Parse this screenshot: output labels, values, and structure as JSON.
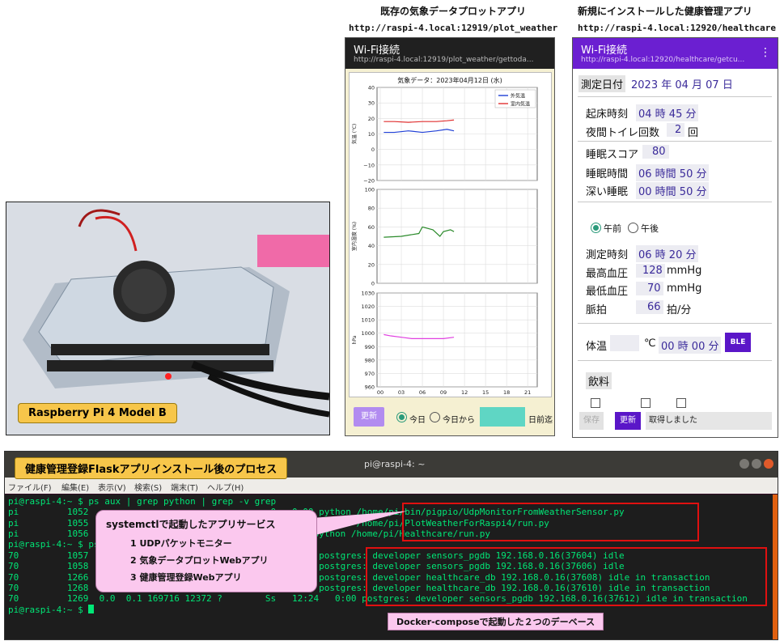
{
  "captions": {
    "plot_app": "既存の気象データプロットアプリ",
    "plot_url": "http://raspi-4.local:12919/plot_weather",
    "hc_app": "新規にインストールした健康管理アプリ",
    "hc_url": "http://raspi-4.local:12920/healthcare"
  },
  "photo": {
    "label": "Raspberry Pi 4 Model B"
  },
  "plot_phone": {
    "title": "Wi-Fi接続",
    "subtitle": "http://raspi-4.local:12919/plot_weather/gettoda...",
    "chart_title": "気象データ：2023年04月12日 (水)",
    "refresh_button": "更新",
    "radio_today": "今日",
    "radio_from_today": "今日から",
    "days_before": "日前迄",
    "colors": {
      "outdoor": "#1f3fd6",
      "indoor": "#e03030",
      "humidity": "#2a8a2a",
      "pressure": "#e040e0"
    }
  },
  "chart_data": [
    {
      "type": "line",
      "ylabel": "気温 (℃)",
      "ylim": [
        -20,
        40
      ],
      "yticks": [
        "40",
        "30",
        "20",
        "10",
        "0",
        "−10",
        "−20"
      ],
      "xticks": [
        "00",
        "03",
        "06",
        "09",
        "12",
        "15",
        "18",
        "21"
      ],
      "legend": "top-right",
      "series": [
        {
          "name": "外気温",
          "x": [
            0.5,
            2,
            4,
            6,
            8,
            9.5,
            10.5
          ],
          "values": [
            11,
            11,
            12,
            11,
            12,
            13,
            12
          ]
        },
        {
          "name": "室内気温",
          "x": [
            0.5,
            2,
            4,
            6,
            8,
            9.5,
            10.5
          ],
          "values": [
            18,
            18,
            17.5,
            18,
            18,
            18.5,
            19
          ]
        }
      ]
    },
    {
      "type": "line",
      "ylabel": "室内湿度 (%)",
      "ylim": [
        0,
        100
      ],
      "yticks": [
        "100",
        "80",
        "60",
        "40",
        "20",
        "0"
      ],
      "xticks": [
        "00",
        "03",
        "06",
        "09",
        "12",
        "15",
        "18",
        "21"
      ],
      "series": [
        {
          "x": [
            0.5,
            3,
            5.5,
            6,
            7.5,
            8.5,
            9,
            10,
            10.5
          ],
          "values": [
            49,
            50,
            53,
            60,
            57,
            50,
            55,
            57,
            55
          ]
        }
      ]
    },
    {
      "type": "line",
      "ylabel": "hPa",
      "ylim": [
        960,
        1030
      ],
      "yticks": [
        "1030",
        "1020",
        "1010",
        "1000",
        "990",
        "980",
        "970",
        "960"
      ],
      "xticks": [
        "00",
        "03",
        "06",
        "09",
        "12",
        "15",
        "18",
        "21"
      ],
      "series": [
        {
          "x": [
            0.5,
            1.5,
            3,
            4.5,
            6,
            7.5,
            9,
            10.5
          ],
          "values": [
            999,
            998,
            997,
            996,
            996,
            996,
            996,
            997
          ]
        }
      ]
    }
  ],
  "hc_phone": {
    "title": "Wi-Fi接続",
    "subtitle": "http://raspi-4.local:12920/healthcare/getcu...",
    "date_label": "測定日付",
    "date_value": "2023 年 04 月 07 日",
    "wake_label": "起床時刻",
    "wake_value": "04 時 45 分",
    "toilet_label": "夜間トイレ回数",
    "toilet_value": "2",
    "toilet_unit": "回",
    "sleep_score_label": "睡眠スコア",
    "sleep_score_value": "80",
    "sleep_time_label": "睡眠時間",
    "sleep_time_value": "06 時間 50 分",
    "deep_sleep_label": "深い睡眠",
    "deep_sleep_value": "00 時間 50 分",
    "am": "午前",
    "pm": "午後",
    "measure_time_label": "測定時刻",
    "measure_time_value": "06 時 20 分",
    "max_bp_label": "最高血圧",
    "max_bp_value": "128",
    "min_bp_label": "最低血圧",
    "min_bp_value": "70",
    "bp_unit": "mmHg",
    "pulse_label": "脈拍",
    "pulse_value": "66",
    "pulse_unit": "拍/分",
    "temp_label": "体温",
    "temp_unit": "℃",
    "temp_time_value": "00 時 00 分",
    "ble_button": "BLE",
    "drink_label": "飲料",
    "save_button": "保存",
    "update_button": "更新",
    "status": "取得しました"
  },
  "terminal": {
    "label": "健康管理登録Flaskアプリインストール後のプロセス",
    "title": "pi@raspi-4: ~",
    "menu": [
      "ファイル(F)",
      "編集(E)",
      "表示(V)",
      "検索(S)",
      "端末(T)",
      "ヘルプ(H)"
    ],
    "lines": [
      "pi@raspi-4:~ $ ps aux | grep python | grep -v grep",
      "pi         1052                                  0   0:00 python /home/pi/bin/pigpio/UdpMonitorFromWeatherSensor.py",
      "pi         1055                                  0   0:00 python /home/pi/PlotWeatherForRaspi4/run.py",
      "pi         1056                                 03  0:00 python /home/pi/Healthcare/run.py",
      "pi@raspi-4:~ $ ps                                  v grep",
      "70         1057                                      0:00 postgres: developer sensors_pgdb 192.168.0.16(37604) idle",
      "70         1058                                      0:00 postgres: developer sensors_pgdb 192.168.0.16(37606) idle",
      "70         1266                                      0:00 postgres: developer healthcare_db 192.168.0.16(37608) idle in transaction",
      "70         1268                                  4   0:00 postgres: developer healthcare_db 192.168.0.16(37610) idle in transaction",
      "70         1269  0.0  0.1 169716 12372 ?        Ss   12:24   0:00 postgres: developer sensors_pgdb 192.168.0.16(37612) idle in transaction",
      "pi@raspi-4:~ $ "
    ],
    "callout_title": "systemctlで起動したアプリサービス",
    "callout_items": [
      "1 UDPパケットモニター",
      "2 気象データプロットWebアプリ",
      "3 健康管理登録Webアプリ"
    ],
    "db_label": "Docker-composeで起動した２つのデーベース"
  }
}
